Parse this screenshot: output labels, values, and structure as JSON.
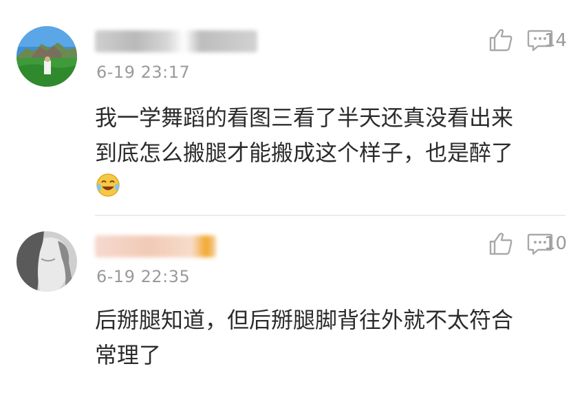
{
  "comments": [
    {
      "time": "6-19 23:17",
      "likes": "14",
      "text_lines": [
        "我一学舞蹈的看图三看了半天还真没看出来",
        "到底怎么搬腿才能搬成这个样子，也是醉了"
      ],
      "emoji": "laughing-tears-emoji"
    },
    {
      "time": "6-19 22:35",
      "likes": "10",
      "text_lines": [
        "后掰腿知道，但后掰腿脚背往外就不太符合",
        "常理了"
      ]
    }
  ],
  "icons": {
    "like": "thumbs-up-icon",
    "reply": "comment-icon"
  },
  "colors": {
    "meta_text": "#9a9a9a",
    "body_text": "#2b2b2b",
    "divider": "#ececec"
  }
}
